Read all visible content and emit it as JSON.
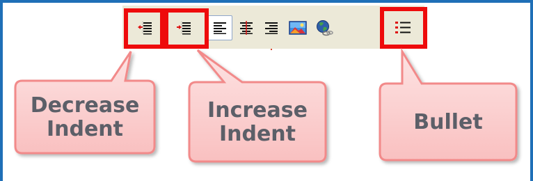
{
  "toolbar": {
    "buttons": [
      {
        "name": "decrease-indent-button",
        "icon": "outdent-icon"
      },
      {
        "name": "increase-indent-button",
        "icon": "indent-icon"
      },
      {
        "name": "align-left-button",
        "icon": "align-left-icon",
        "active": true
      },
      {
        "name": "align-center-button",
        "icon": "align-center-icon"
      },
      {
        "name": "align-right-button",
        "icon": "align-right-icon"
      },
      {
        "name": "insert-image-button",
        "icon": "image-icon"
      },
      {
        "name": "insert-link-button",
        "icon": "globe-link-icon"
      },
      {
        "name": "bullet-list-button",
        "icon": "bullet-list-icon"
      }
    ]
  },
  "callouts": {
    "decrease_indent": "Decrease\nIndent",
    "increase_indent": "Increase\nIndent",
    "bullet": "Bullet"
  },
  "colors": {
    "highlight": "#ee0b0b",
    "callout_fill": "#fbd3d3",
    "callout_border": "#f28a8a",
    "callout_text": "#5c5f68",
    "frame": "#1f6fb7",
    "toolbar_bg": "#ece9d8"
  }
}
